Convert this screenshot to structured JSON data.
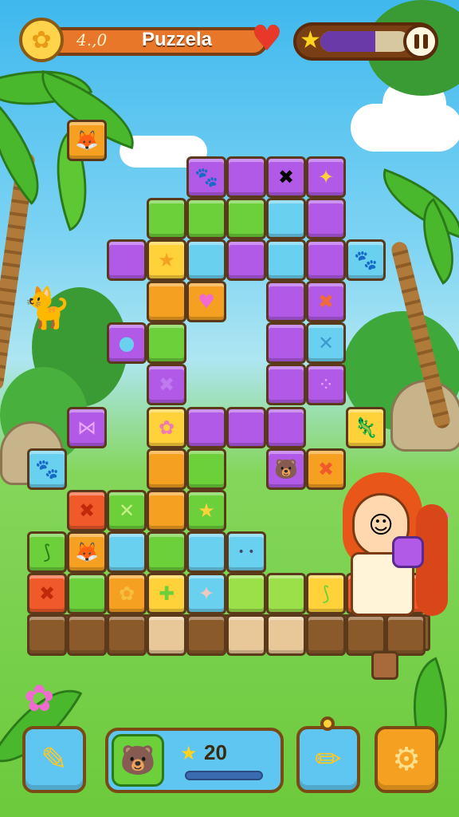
{
  "hud": {
    "score_label": "4.,0",
    "title": "Puzzela",
    "flower_icon": "flower-icon",
    "heart_icon": "heart-icon",
    "star_icon": "star-icon",
    "progress": 0.62
  },
  "bottom": {
    "coin_value": "20",
    "left_tool_icon": "crayon-icon",
    "right_tool_icon": "pencil-icon",
    "settings_icon": "gear-icon",
    "animal_icon": "bear-icon"
  },
  "colors": {
    "purple": "#b25ae8",
    "green": "#6bd03a",
    "orange": "#f5a020",
    "yellow": "#ffd23a",
    "blue": "#6ad0f0",
    "red": "#f05a2a"
  }
}
